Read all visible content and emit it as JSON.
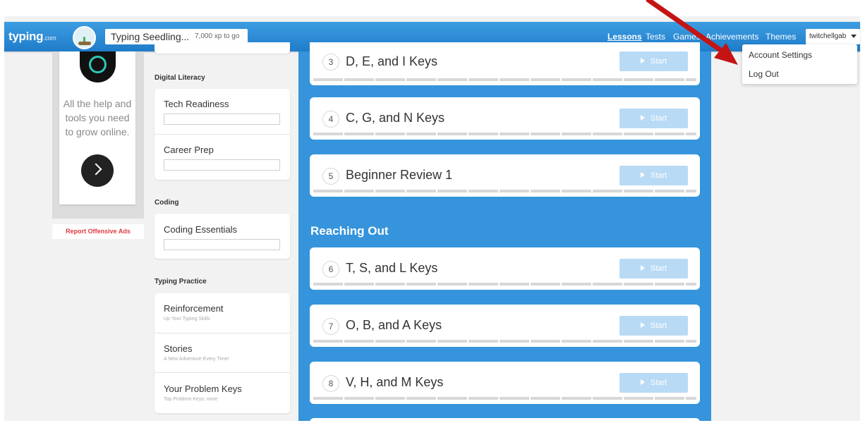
{
  "header": {
    "logo": "typing",
    "logo_suffix": ".com",
    "level_name": "Typing Seedling...",
    "xp_to_go": "7,000 xp to go",
    "nav": [
      "Lessons",
      "Tests",
      "Games",
      "Achievements",
      "Themes"
    ],
    "active_nav": "Lessons",
    "username": "twitchellgab"
  },
  "user_menu": {
    "items": [
      "Account Settings",
      "Log Out"
    ]
  },
  "ad": {
    "text": "All the help and tools you need to grow online.",
    "report_link": "Report Offensive Ads"
  },
  "sidebar": {
    "sections": [
      {
        "heading": "Digital Literacy",
        "items": [
          "Tech Readiness",
          "Career Prep"
        ]
      },
      {
        "heading": "Coding",
        "items": [
          "Coding Essentials"
        ]
      },
      {
        "heading": "Typing Practice",
        "items": [
          {
            "label": "Reinforcement",
            "sub": "Up Your Typing Skills"
          },
          {
            "label": "Stories",
            "sub": "A New Adventure Every Time!"
          },
          {
            "label": "Your Problem Keys",
            "sub": "Top Problem Keys: none"
          }
        ]
      }
    ]
  },
  "lessons": {
    "start_label": "Start",
    "section_title": "Reaching Out",
    "items": [
      {
        "num": "3",
        "title": "D, E, and I Keys"
      },
      {
        "num": "4",
        "title": "C, G, and N Keys"
      },
      {
        "num": "5",
        "title": "Beginner Review 1"
      },
      {
        "num": "6",
        "title": "T, S, and L Keys"
      },
      {
        "num": "7",
        "title": "O, B, and A Keys"
      },
      {
        "num": "8",
        "title": "V, H, and M Keys"
      }
    ]
  },
  "colors": {
    "header_blue": "#2a8bd6",
    "lesson_bg": "#3594db",
    "start_button": "#b9daf4",
    "report_red": "#e0393e",
    "annotation_arrow": "#c41414"
  },
  "icons": [
    "avatar-seedling-icon",
    "ad-logo-icon",
    "chevron-right-icon",
    "caret-down-icon",
    "play-icon"
  ]
}
